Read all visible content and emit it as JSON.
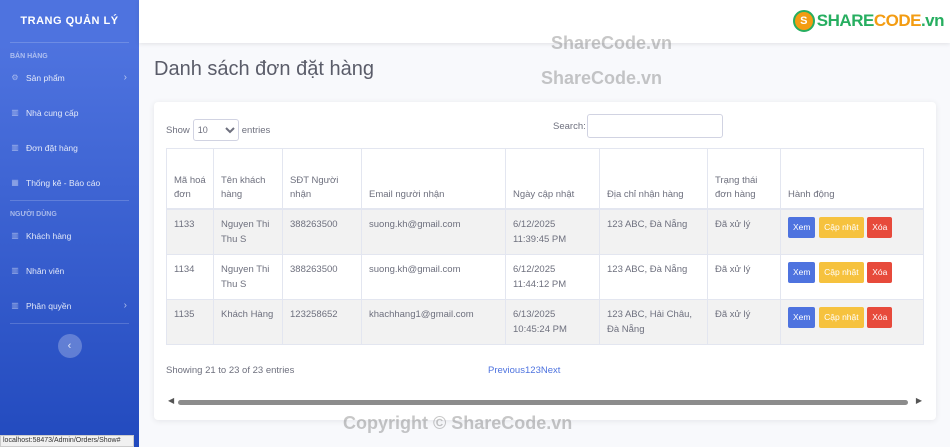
{
  "sidebar": {
    "brand": "TRANG QUẢN LÝ",
    "heading_sales": "BÁN HÀNG",
    "heading_users": "NGƯỜI DÙNG",
    "items": [
      {
        "label": "Sản phẩm",
        "icon": "gear-icon"
      },
      {
        "label": "Nhà cung cấp",
        "icon": "chart-icon"
      },
      {
        "label": "Đơn đặt hàng",
        "icon": "chart-icon"
      },
      {
        "label": "Thống kê - Báo cáo",
        "icon": "table-icon"
      },
      {
        "label": "Khách hàng",
        "icon": "chart-icon"
      },
      {
        "label": "Nhân viên",
        "icon": "chart-icon"
      },
      {
        "label": "Phân quyền",
        "icon": "chart-icon"
      }
    ],
    "toggle": "‹"
  },
  "status_url": "localhost:58473/Admin/Orders/Show#",
  "logo": {
    "a": "SHARE",
    "b": "CODE",
    "suffix": ".vn"
  },
  "watermarks": [
    "ShareCode.vn",
    "ShareCode.vn",
    "Copyright © ShareCode.vn"
  ],
  "page_title": "Danh sách đơn đặt hàng",
  "controls": {
    "show_label": "Show",
    "entries_label": "entries",
    "page_size": "10",
    "search_label": "Search:"
  },
  "table": {
    "headers": [
      "Mã hoá đơn",
      "Tên khách hàng",
      "SĐT Người nhận",
      "Email người nhận",
      "Ngày cập nhật",
      "Địa chỉ nhận hàng",
      "Trạng thái đơn hàng",
      "Hành động"
    ],
    "rows": [
      {
        "id": "1133",
        "name": "Nguyen Thi Thu S",
        "phone": "388263500",
        "email": "suong.kh@gmail.com",
        "date": "6/12/2025 11:39:45 PM",
        "address": "123 ABC, Đà Nẵng",
        "status": "Đã xử lý"
      },
      {
        "id": "1134",
        "name": "Nguyen Thi Thu S",
        "phone": "388263500",
        "email": "suong.kh@gmail.com",
        "date": "6/12/2025 11:44:12 PM",
        "address": "123 ABC, Đà Nẵng",
        "status": "Đã xử lý"
      },
      {
        "id": "1135",
        "name": "Khách Hàng",
        "phone": "123258652",
        "email": "khachhang1@gmail.com",
        "date": "6/13/2025 10:45:24 PM",
        "address": "123 ABC, Hải Châu, Đà Nẵng",
        "status": "Đã xử lý"
      }
    ],
    "actions": {
      "view": "Xem",
      "edit": "Cập nhật",
      "delete": "Xóa"
    }
  },
  "info": "Showing 21 to 23 of 23 entries",
  "pager": {
    "prev": "Previous",
    "pages": [
      "1",
      "2",
      "3"
    ],
    "next": "Next"
  },
  "colors": {
    "primary": "#4e73df",
    "warning": "#f6c23e",
    "danger": "#e74a3b"
  }
}
